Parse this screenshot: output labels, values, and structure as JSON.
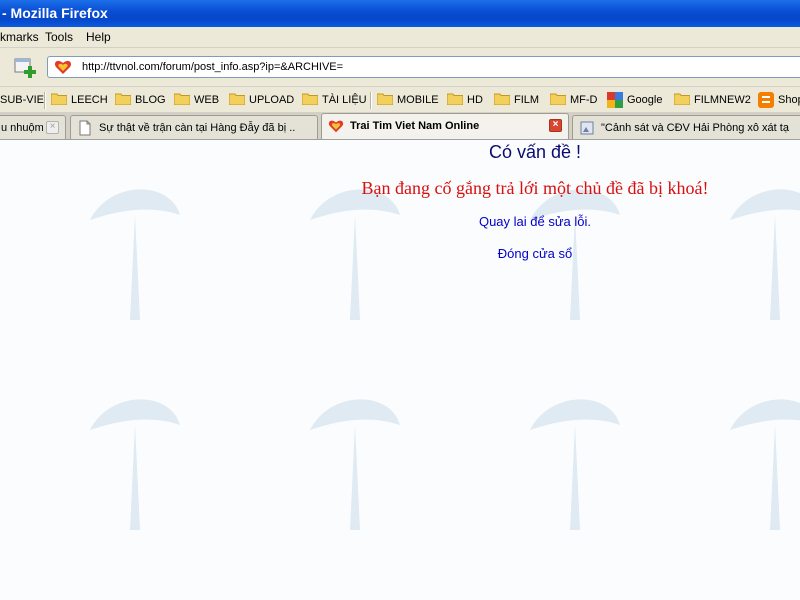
{
  "window": {
    "title": "- Mozilla Firefox"
  },
  "menu": {
    "bookmarks": "kmarks",
    "tools": "Tools",
    "help": "Help"
  },
  "nav": {
    "url": "http://ttvnol.com/forum/post_info.asp?ip=&ARCHIVE="
  },
  "bookmarks": [
    {
      "label": "SUB-VIE",
      "icon": "folder-icon"
    },
    {
      "label": "LEECH",
      "icon": "folder-icon"
    },
    {
      "label": "BLOG",
      "icon": "folder-icon"
    },
    {
      "label": "WEB",
      "icon": "folder-icon"
    },
    {
      "label": "UPLOAD",
      "icon": "folder-icon"
    },
    {
      "label": "TÀI LIỆU",
      "icon": "folder-icon"
    },
    {
      "label": "MOBILE",
      "icon": "folder-icon"
    },
    {
      "label": "HD",
      "icon": "folder-icon"
    },
    {
      "label": "FILM",
      "icon": "folder-icon"
    },
    {
      "label": "MF-D",
      "icon": "folder-icon"
    },
    {
      "label": "Google",
      "icon": "google-icon"
    },
    {
      "label": "FILMNEW2",
      "icon": "folder-icon"
    },
    {
      "label": "Shop",
      "icon": "blogger-icon"
    }
  ],
  "tabs": [
    {
      "label": "u nhuộm...",
      "active": false
    },
    {
      "label": "Sự thật về trận càn tại Hàng Đẫy đã bị ...",
      "active": false
    },
    {
      "label": "Trai Tim Viet Nam Online",
      "active": true
    },
    {
      "label": "\"Cảnh sát và CĐV Hải Phòng xô xát tại ...",
      "active": false
    }
  ],
  "page": {
    "title": "Có vấn đề !",
    "error": "Bạn đang cố gắng trả lới một chủ đề đã bị khoá!",
    "back_link": "Quay lai để sửa lỗi.",
    "close_link": "Đóng cửa sổ"
  },
  "colors": {
    "titlebar": "#0a4fd6",
    "chrome": "#ece9d8",
    "error_text": "#d81010",
    "link": "#0000cc"
  }
}
